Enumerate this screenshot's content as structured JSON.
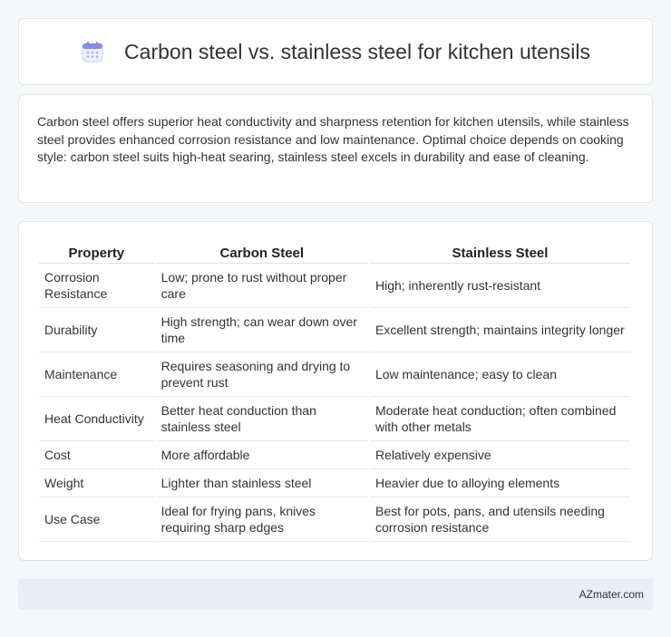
{
  "header": {
    "title": "Carbon steel vs. stainless steel for kitchen utensils",
    "icon": "calendar-icon",
    "accent": "#7b8ff0"
  },
  "summary": {
    "text": "Carbon steel offers superior heat conductivity and sharpness retention for kitchen utensils, while stainless steel provides enhanced corrosion resistance and low maintenance. Optimal choice depends on cooking style: carbon steel suits high-heat searing, stainless steel excels in durability and ease of cleaning."
  },
  "table": {
    "headers": [
      "Property",
      "Carbon Steel",
      "Stainless Steel"
    ],
    "rows": [
      [
        "Corrosion Resistance",
        "Low; prone to rust without proper care",
        "High; inherently rust-resistant"
      ],
      [
        "Durability",
        "High strength; can wear down over time",
        "Excellent strength; maintains integrity longer"
      ],
      [
        "Maintenance",
        "Requires seasoning and drying to prevent rust",
        "Low maintenance; easy to clean"
      ],
      [
        "Heat Conductivity",
        "Better heat conduction than stainless steel",
        "Moderate heat conduction; often combined with other metals"
      ],
      [
        "Cost",
        "More affordable",
        "Relatively expensive"
      ],
      [
        "Weight",
        "Lighter than stainless steel",
        "Heavier due to alloying elements"
      ],
      [
        "Use Case",
        "Ideal for frying pans, knives requiring sharp edges",
        "Best for pots, pans, and utensils needing corrosion resistance"
      ]
    ]
  },
  "footer": {
    "text": "AZmater.com"
  }
}
